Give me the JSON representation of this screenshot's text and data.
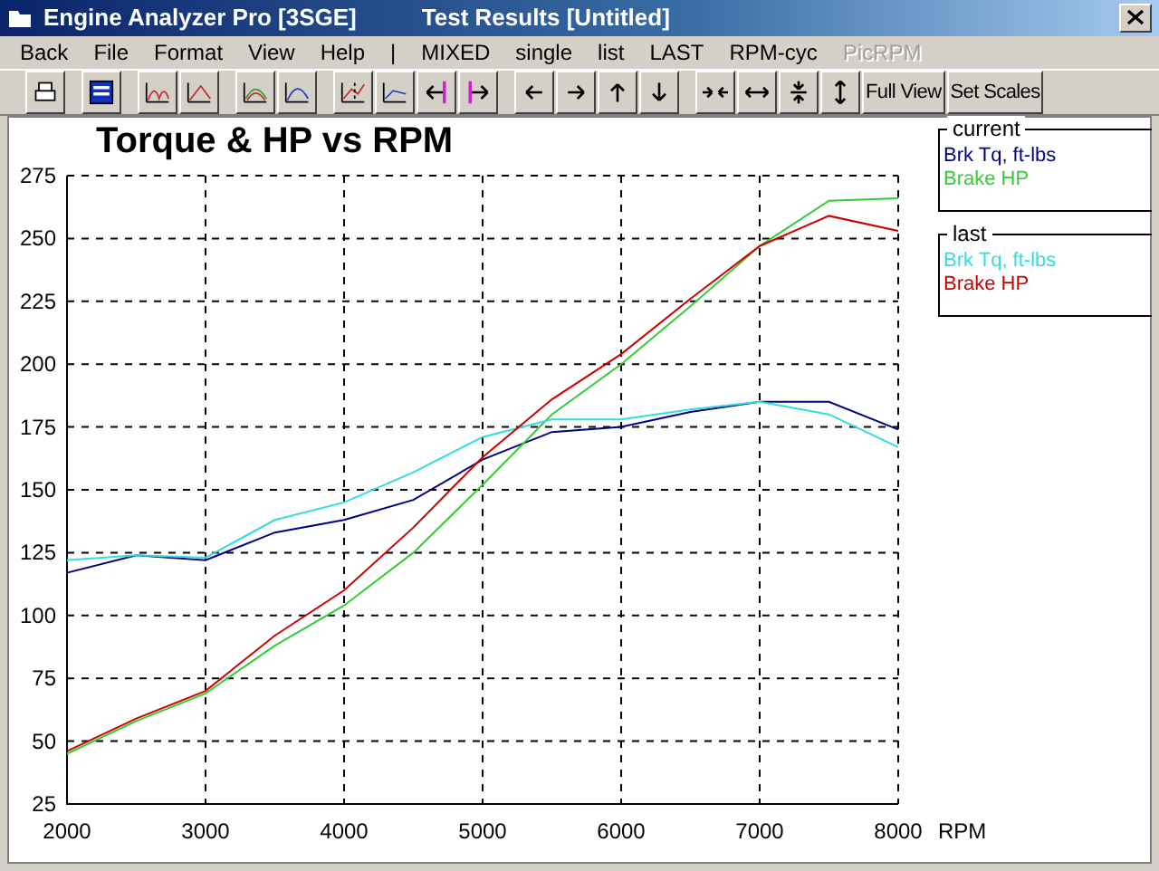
{
  "window": {
    "title": "Engine Analyzer Pro [3SGE]",
    "subtitle": "Test Results [Untitled]"
  },
  "menu": [
    {
      "label": "Back",
      "disabled": false
    },
    {
      "label": "File",
      "disabled": false
    },
    {
      "label": "Format",
      "disabled": false
    },
    {
      "label": "View",
      "disabled": false
    },
    {
      "label": "Help",
      "disabled": false
    },
    {
      "label": "|",
      "disabled": false
    },
    {
      "label": "MIXED",
      "disabled": false
    },
    {
      "label": "single",
      "disabled": false
    },
    {
      "label": "list",
      "disabled": false
    },
    {
      "label": "LAST",
      "disabled": false
    },
    {
      "label": "RPM-cyc",
      "disabled": false
    },
    {
      "label": "PicRPM",
      "disabled": true
    }
  ],
  "toolbar": {
    "text_buttons": [
      "Full View",
      "Set Scales"
    ]
  },
  "chart": {
    "chart_data": {
      "type": "line",
      "title": "Torque & HP vs RPM",
      "xlabel": "RPM",
      "x": [
        2000,
        2500,
        3000,
        3500,
        4000,
        4500,
        5000,
        5500,
        6000,
        6500,
        7000,
        7500,
        8000
      ],
      "xlim": [
        2000,
        8000
      ],
      "ylim": [
        25,
        275
      ],
      "xticks": [
        2000,
        3000,
        4000,
        5000,
        6000,
        7000,
        8000
      ],
      "yticks": [
        25,
        50,
        75,
        100,
        125,
        150,
        175,
        200,
        225,
        250,
        275
      ],
      "grid": true,
      "series": [
        {
          "name": "Brk Tq, ft-lbs",
          "color": "#000080",
          "values": [
            117,
            124,
            122,
            133,
            138,
            146,
            162,
            173,
            175,
            181,
            185,
            185,
            174
          ]
        },
        {
          "name": "Brake HP",
          "color": "#33cc33",
          "values": [
            45,
            58,
            69,
            88,
            104,
            125,
            152,
            180,
            200,
            223,
            247,
            265,
            266
          ]
        },
        {
          "name": "Brk Tq, ft-lbs",
          "color": "#33dddd",
          "values": [
            122,
            124,
            123,
            138,
            145,
            157,
            171,
            178,
            178,
            182,
            185,
            180,
            167
          ]
        },
        {
          "name": "Brake HP",
          "color": "#cc0000",
          "values": [
            46,
            59,
            70,
            92,
            110,
            135,
            163,
            186,
            204,
            226,
            247,
            259,
            253
          ]
        }
      ]
    }
  },
  "legend": [
    {
      "title": "current"
    },
    {
      "title": "last"
    }
  ]
}
